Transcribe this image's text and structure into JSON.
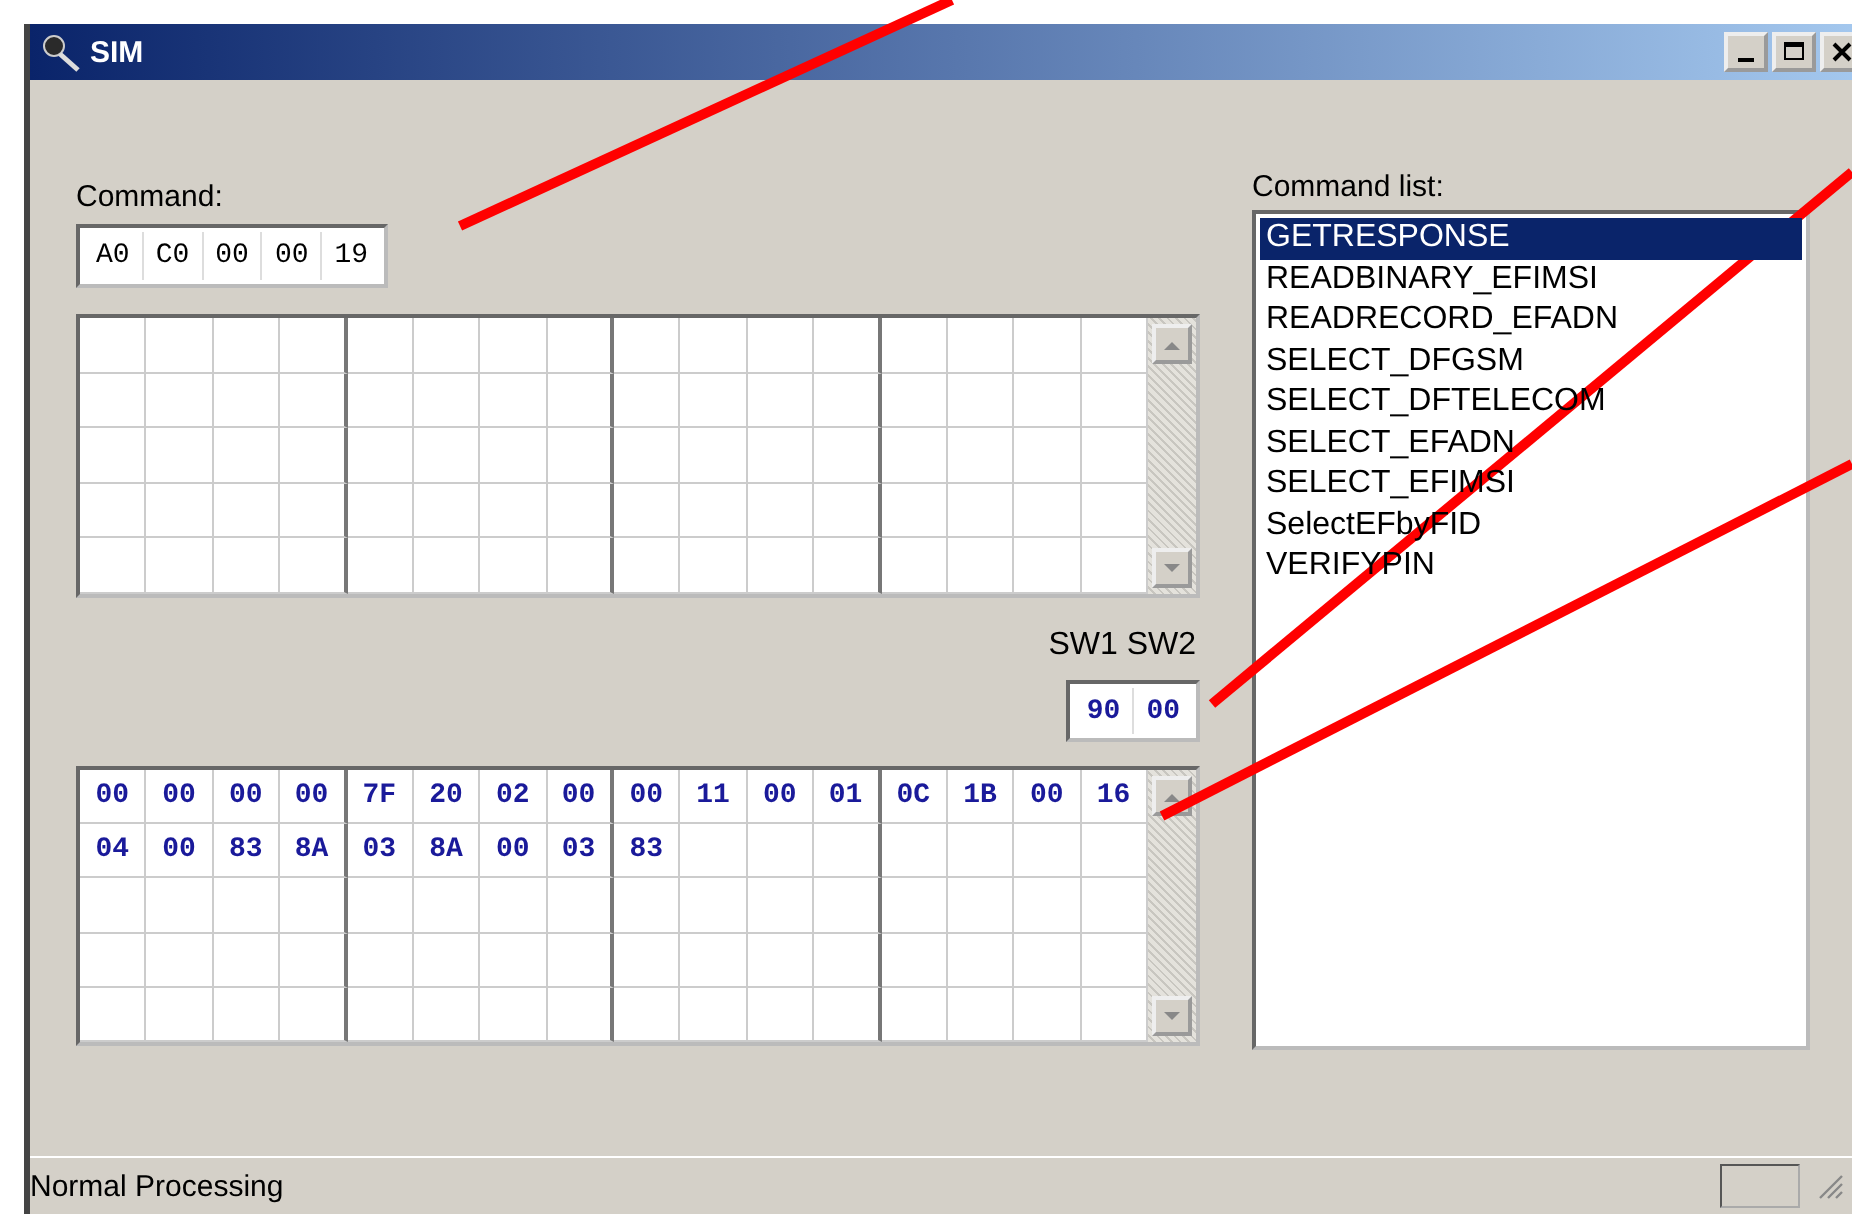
{
  "window": {
    "title": "SIM"
  },
  "command": {
    "label": "Command:",
    "bytes": [
      "A0",
      "C0",
      "00",
      "00",
      "19"
    ]
  },
  "status_words": {
    "label": "SW1 SW2",
    "values": [
      "90",
      "00"
    ]
  },
  "response": {
    "rows": [
      [
        "00",
        "00",
        "00",
        "00",
        "7F",
        "20",
        "02",
        "00",
        "00",
        "11",
        "00",
        "01",
        "0C",
        "1B",
        "00",
        "16"
      ],
      [
        "04",
        "00",
        "83",
        "8A",
        "03",
        "8A",
        "00",
        "03",
        "83"
      ]
    ]
  },
  "command_list": {
    "label": "Command list:",
    "items": [
      {
        "label": "GETRESPONSE",
        "selected": true
      },
      {
        "label": "READBINARY_EFIMSI",
        "selected": false
      },
      {
        "label": "READRECORD_EFADN",
        "selected": false
      },
      {
        "label": "SELECT_DFGSM",
        "selected": false
      },
      {
        "label": "SELECT_DFTELECOM",
        "selected": false
      },
      {
        "label": "SELECT_EFADN",
        "selected": false
      },
      {
        "label": "SELECT_EFIMSI",
        "selected": false
      },
      {
        "label": "SelectEFbyFID",
        "selected": false
      },
      {
        "label": "VERIFYPIN",
        "selected": false
      }
    ]
  },
  "status_bar": {
    "text": "Normal Processing"
  }
}
